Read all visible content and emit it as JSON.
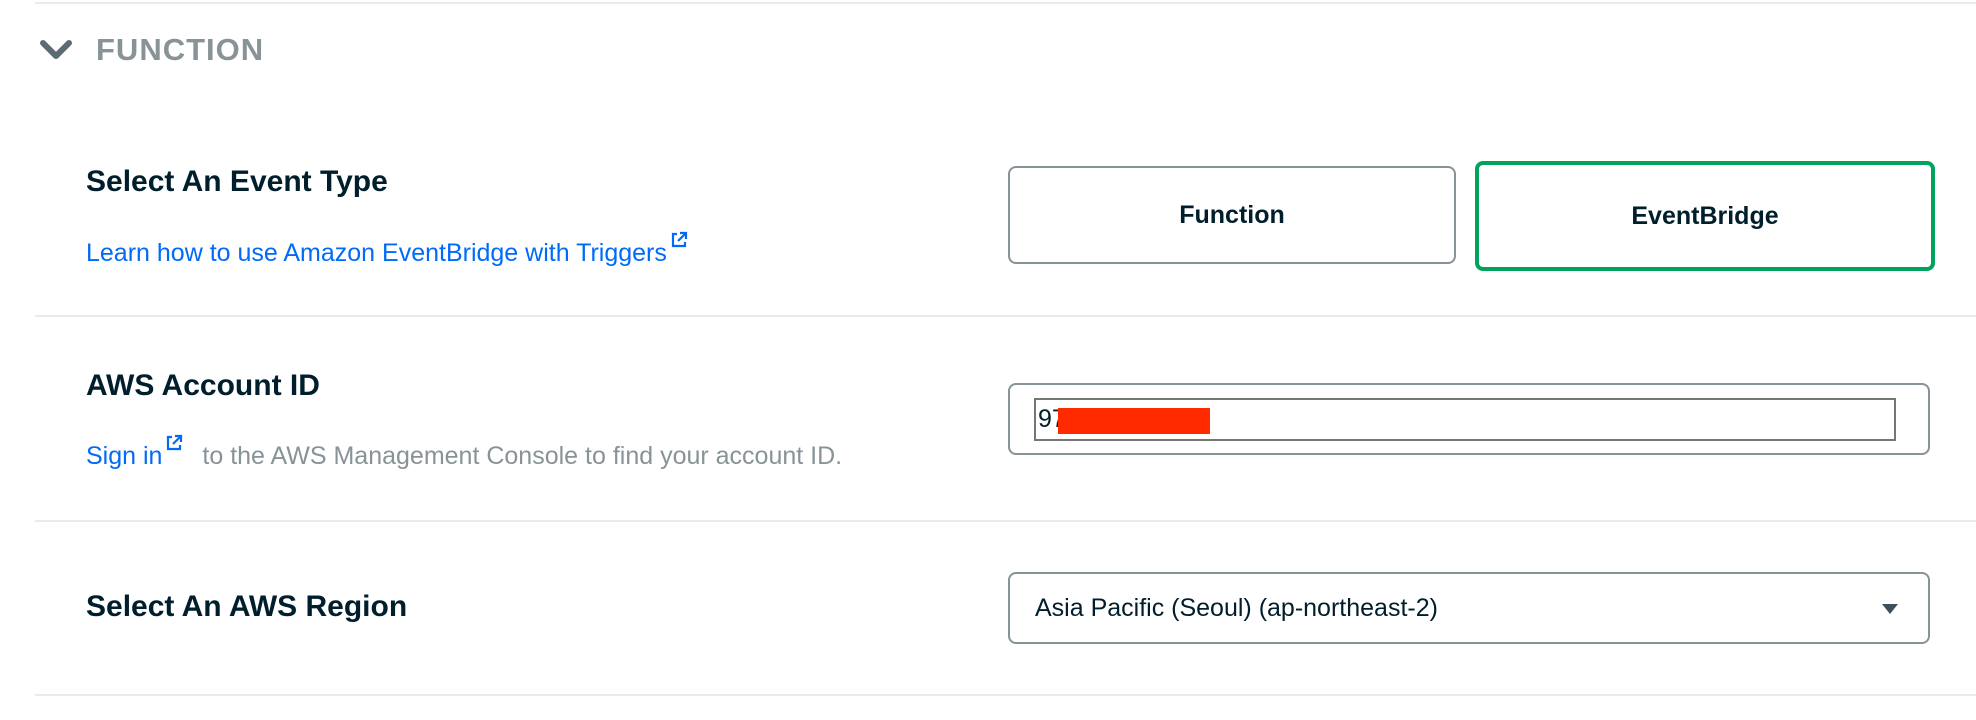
{
  "section": {
    "title": "FUNCTION",
    "collapse_icon": "chevron-down-icon"
  },
  "event_type": {
    "title": "Select An Event Type",
    "link_text": "Learn how to use Amazon EventBridge with Triggers",
    "link_icon": "external-link-icon",
    "options": [
      {
        "label": "Function",
        "selected": false
      },
      {
        "label": "EventBridge",
        "selected": true
      }
    ],
    "selected_color": "#00a35c"
  },
  "account": {
    "title": "AWS Account ID",
    "signin_link": "Sign in",
    "signin_icon": "external-link-icon",
    "description": "to the AWS Management Console to find your account ID.",
    "input_value": "97",
    "redaction_color": "#ff2a00"
  },
  "region": {
    "title": "Select An AWS Region",
    "selected": "Asia Pacific (Seoul) (ap-northeast-2)",
    "dropdown_icon": "caret-down-icon"
  },
  "colors": {
    "link": "#016bf8",
    "heading": "#001e2b",
    "muted": "#889397"
  }
}
